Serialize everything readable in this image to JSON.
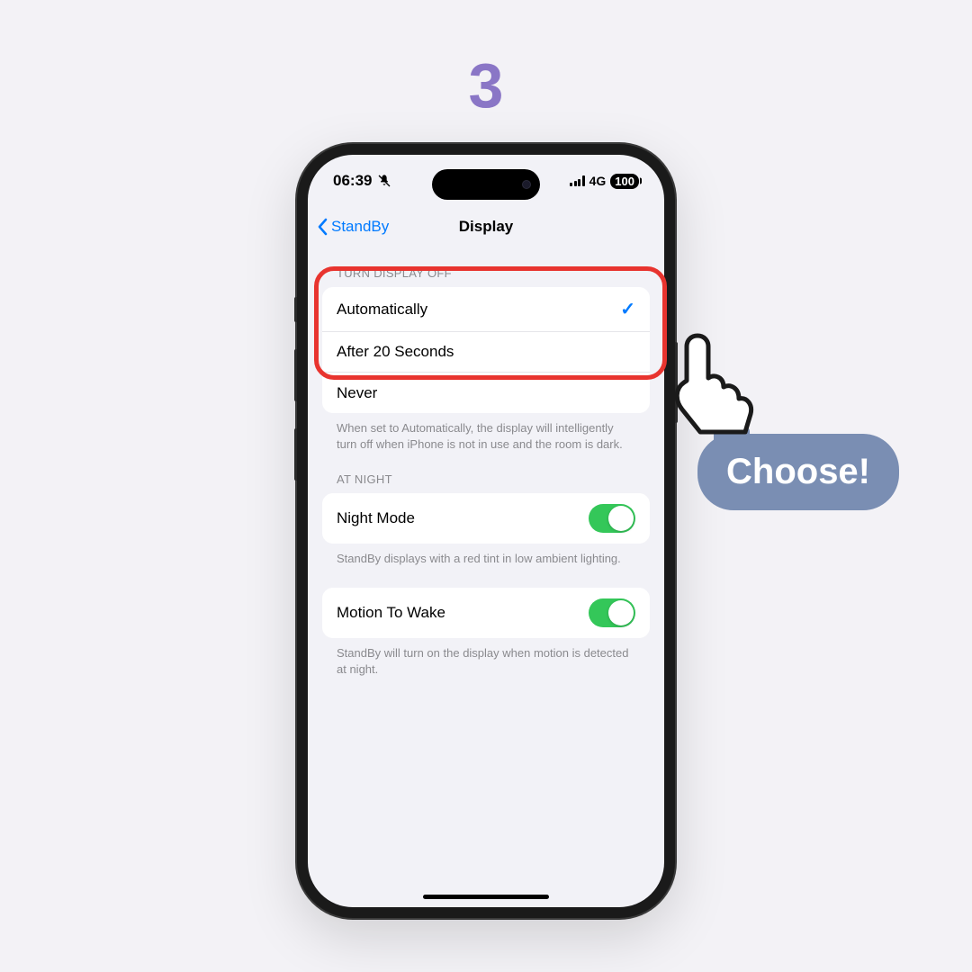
{
  "step": "3",
  "statusBar": {
    "time": "06:39",
    "network": "4G",
    "battery": "100"
  },
  "nav": {
    "back": "StandBy",
    "title": "Display"
  },
  "section1": {
    "header": "TURN DISPLAY OFF",
    "items": [
      "Automatically",
      "After 20 Seconds",
      "Never"
    ],
    "footer": "When set to Automatically, the display will intelligently turn off when iPhone is not in use and the room is dark."
  },
  "section2": {
    "header": "AT NIGHT",
    "item": "Night Mode",
    "footer": "StandBy displays with a red tint in low ambient lighting."
  },
  "section3": {
    "item": "Motion To Wake",
    "footer": "StandBy will turn on the display when motion is detected at night."
  },
  "callout": "Choose!"
}
